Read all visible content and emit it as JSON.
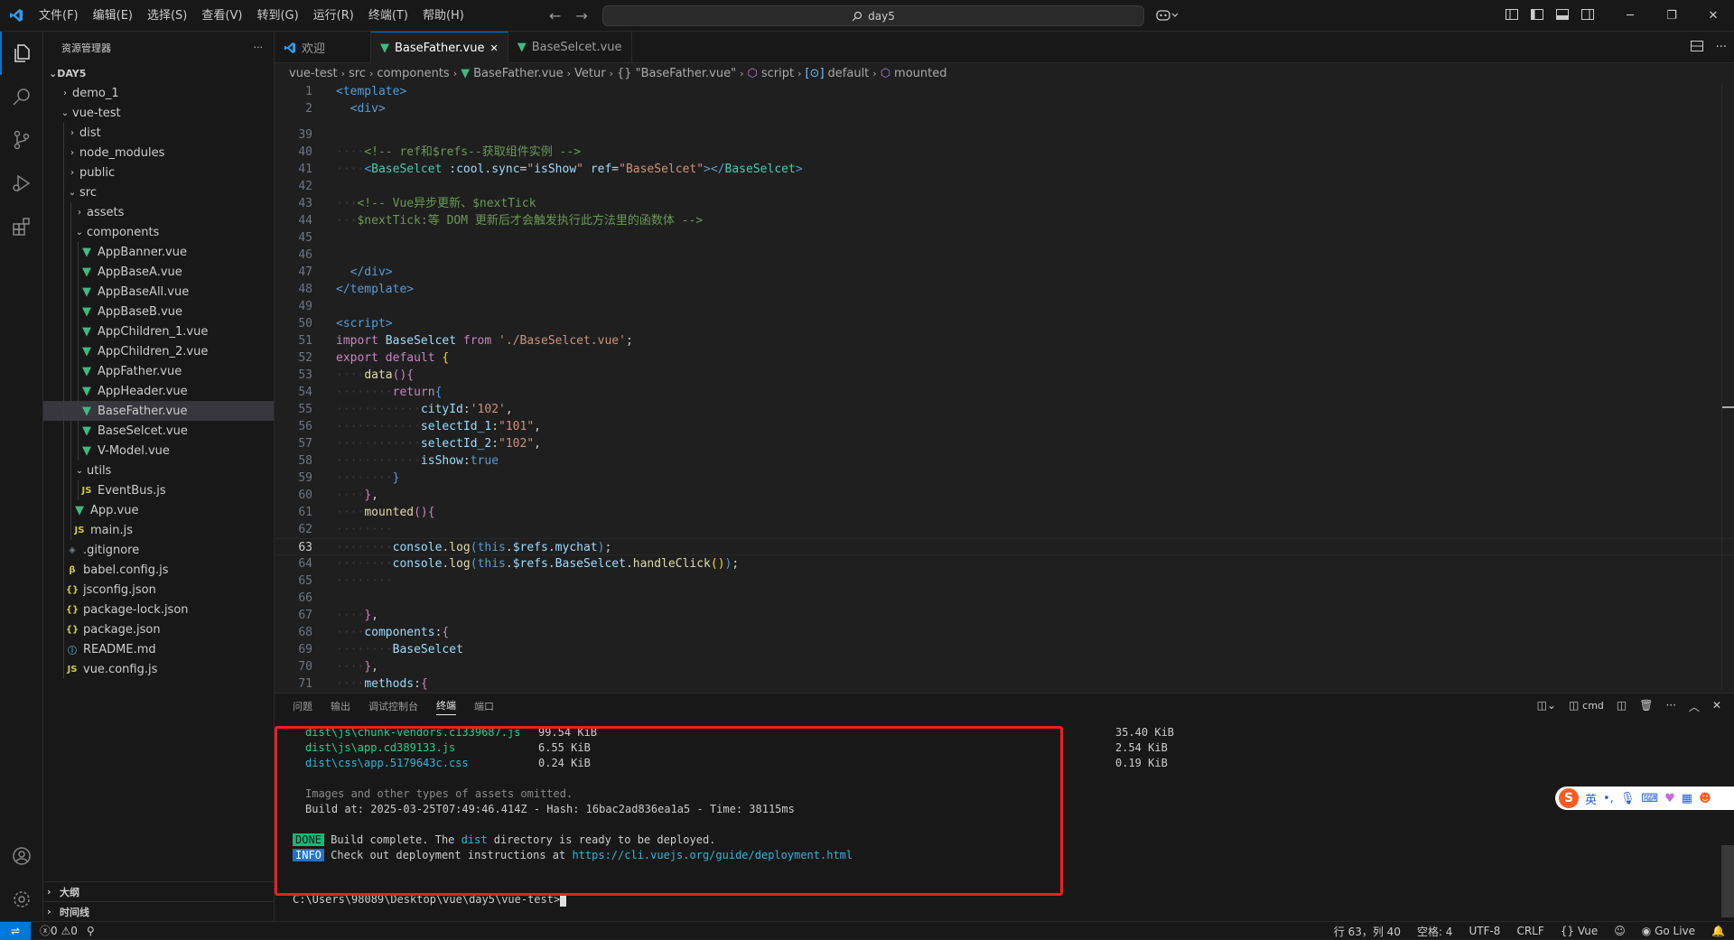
{
  "titlebar": {
    "menu": [
      "文件(F)",
      "编辑(E)",
      "选择(S)",
      "查看(V)",
      "转到(G)",
      "运行(R)",
      "终端(T)",
      "帮助(H)"
    ],
    "search_text": "day5",
    "nav_back": "←",
    "nav_forward": "→"
  },
  "sidebar": {
    "title": "资源管理器",
    "more": "···",
    "root": "DAY5",
    "items": [
      {
        "label": "demo_1"
      },
      {
        "label": "vue-test"
      },
      {
        "label": "dist"
      },
      {
        "label": "node_modules"
      },
      {
        "label": "public"
      },
      {
        "label": "src"
      },
      {
        "label": "assets"
      },
      {
        "label": "components"
      },
      {
        "label": "AppBanner.vue"
      },
      {
        "label": "AppBaseA.vue"
      },
      {
        "label": "AppBaseAll.vue"
      },
      {
        "label": "AppBaseB.vue"
      },
      {
        "label": "AppChildren_1.vue"
      },
      {
        "label": "AppChildren_2.vue"
      },
      {
        "label": "AppFather.vue"
      },
      {
        "label": "AppHeader.vue"
      },
      {
        "label": "BaseFather.vue"
      },
      {
        "label": "BaseSelcet.vue"
      },
      {
        "label": "V-Model.vue"
      },
      {
        "label": "utils"
      },
      {
        "label": "EventBus.js"
      },
      {
        "label": "App.vue"
      },
      {
        "label": "main.js"
      },
      {
        "label": ".gitignore"
      },
      {
        "label": "babel.config.js"
      },
      {
        "label": "jsconfig.json"
      },
      {
        "label": "package-lock.json"
      },
      {
        "label": "package.json"
      },
      {
        "label": "README.md"
      },
      {
        "label": "vue.config.js"
      }
    ],
    "sections": [
      "大纲",
      "时间线"
    ]
  },
  "tabs": [
    {
      "label": "欢迎"
    },
    {
      "label": "BaseFather.vue",
      "close": "✕"
    },
    {
      "label": "BaseSelcet.vue"
    }
  ],
  "breadcrumb": {
    "parts": [
      "vue-test",
      "src",
      "components",
      "BaseFather.vue",
      "Vetur",
      "{} \"BaseFather.vue\"",
      "script",
      "default",
      "mounted"
    ]
  },
  "editor": {
    "line_numbers": [
      "1",
      "2",
      "39",
      "40",
      "41",
      "42",
      "43",
      "44",
      "45",
      "46",
      "47",
      "48",
      "49",
      "50",
      "51",
      "52",
      "53",
      "54",
      "55",
      "56",
      "57",
      "58",
      "59",
      "60",
      "61",
      "62",
      "63",
      "64",
      "65",
      "66",
      "67",
      "68",
      "69",
      "70",
      "71"
    ],
    "current_line": "63"
  },
  "panel": {
    "tabs": [
      "问题",
      "输出",
      "调试控制台",
      "终端",
      "端口"
    ],
    "shell": "cmd",
    "terminal": {
      "rows": [
        {
          "file": "dist\\js\\chunk-vendors.c1339687.js",
          "size": "99.54 KiB",
          "gzip": "35.40 KiB"
        },
        {
          "file": "dist\\js\\app.cd389133.js",
          "size": "6.55 KiB",
          "gzip": "2.54 KiB"
        },
        {
          "file": "dist\\css\\app.5179643c.css",
          "size": "0.24 KiB",
          "gzip": "0.19 KiB"
        }
      ],
      "omitted": "Images and other types of assets omitted.",
      "build_at": "Build at: 2025-03-25T07:49:46.414Z - Hash: 16bac2ad836ea1a5 - Time: 38115ms",
      "done_badge": "DONE",
      "done_pre": "Build complete. The ",
      "done_dir": "dist",
      "done_post": " directory is ready to be deployed.",
      "info_badge": "INFO",
      "info_pre": "Check out deployment instructions at ",
      "info_link": "https://cli.vuejs.org/guide/deployment.html",
      "prompt": "C:\\Users\\98089\\Desktop\\vue\\day5\\vue-test>"
    }
  },
  "ime": {
    "logo": "S",
    "mode": "英",
    "punct": "•,"
  },
  "statusbar": {
    "errors": "0",
    "warnings": "0",
    "position": "行 63，列 40",
    "spaces": "空格: 4",
    "encoding": "UTF-8",
    "eol": "CRLF",
    "language": "Vue",
    "golive": "Go Live"
  },
  "colors": {
    "accent": "#0078d4",
    "highlight_box": "#e8221e",
    "vue_green": "#41b883"
  }
}
